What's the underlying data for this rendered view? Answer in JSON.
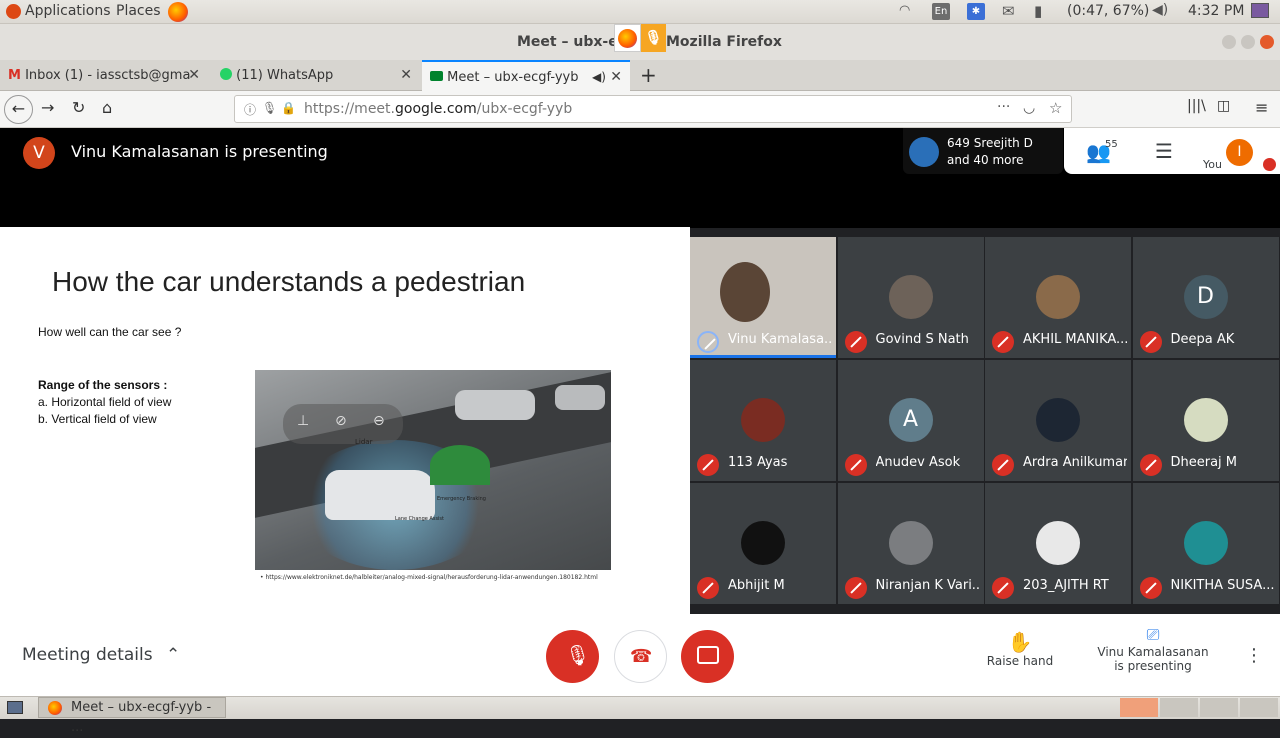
{
  "top_panel": {
    "applications": "Applications",
    "places": "Places",
    "keyboard": "En",
    "battery": "(0:47, 67%)",
    "clock": "4:32 PM"
  },
  "window": {
    "title_left": "Meet – ubx-ec",
    "title_right": "Mozilla Firefox"
  },
  "tabs": [
    {
      "label": "Inbox (1) - iassctsb@gma"
    },
    {
      "label": "(11) WhatsApp"
    },
    {
      "label": "Meet – ubx-ecgf-yyb"
    }
  ],
  "url": {
    "prefix": "https://meet.",
    "domain": "google.com",
    "path": "/ubx-ecgf-yyb"
  },
  "meet": {
    "presenter_initial": "V",
    "presenting_banner": "Vinu Kamalasanan is presenting",
    "participants_line1": "649 Sreejith D",
    "participants_line2": "and 40 more",
    "people_count": "55",
    "you_label": "You",
    "you_initial": "I"
  },
  "slide": {
    "title": "How the car understands a pedestrian",
    "question": "How well can the car see ?",
    "range_heading": "Range of the sensors :",
    "range_a": "a. Horizontal field of view",
    "range_b": "b. Vertical field of view",
    "img_label_lidar": "Lidar",
    "img_label_lane": "Lane Change Assist",
    "img_label_brake": "Emergency Braking",
    "caption": "• https://www.elektroniknet.de/halbleiter/analog-mixed-signal/herausforderung-lidar-anwendungen.180182.html"
  },
  "participants": [
    {
      "name": "Vinu Kamalasa...",
      "color": "#c9c4bd"
    },
    {
      "name": "Govind S Nath",
      "color": "#6d6259"
    },
    {
      "name": "AKHIL MANIKA...",
      "color": "#8a6a4a"
    },
    {
      "name": "Deepa AK",
      "initial": "D",
      "color": "#455a64"
    },
    {
      "name": "113 Ayas",
      "color": "#7a2c22"
    },
    {
      "name": "Anudev Asok",
      "initial": "A",
      "color": "#607d8b"
    },
    {
      "name": "Ardra Anilkumar",
      "color": "#1d2633"
    },
    {
      "name": "Dheeraj M",
      "color": "#d6dcc1"
    },
    {
      "name": "Abhijit M",
      "color": "#111111"
    },
    {
      "name": "Niranjan K Vari...",
      "color": "#7b7d80"
    },
    {
      "name": "203_AJITH RT",
      "color": "#e8e8e8"
    },
    {
      "name": "NIKITHA SUSA...",
      "color": "#1f8f93"
    }
  ],
  "bottom": {
    "meeting_details": "Meeting details",
    "raise_hand": "Raise hand",
    "presenting_line1": "Vinu Kamalasanan",
    "presenting_line2": "is presenting"
  },
  "taskbar": {
    "window_item": "Meet – ubx-ecgf-yyb - ..."
  }
}
